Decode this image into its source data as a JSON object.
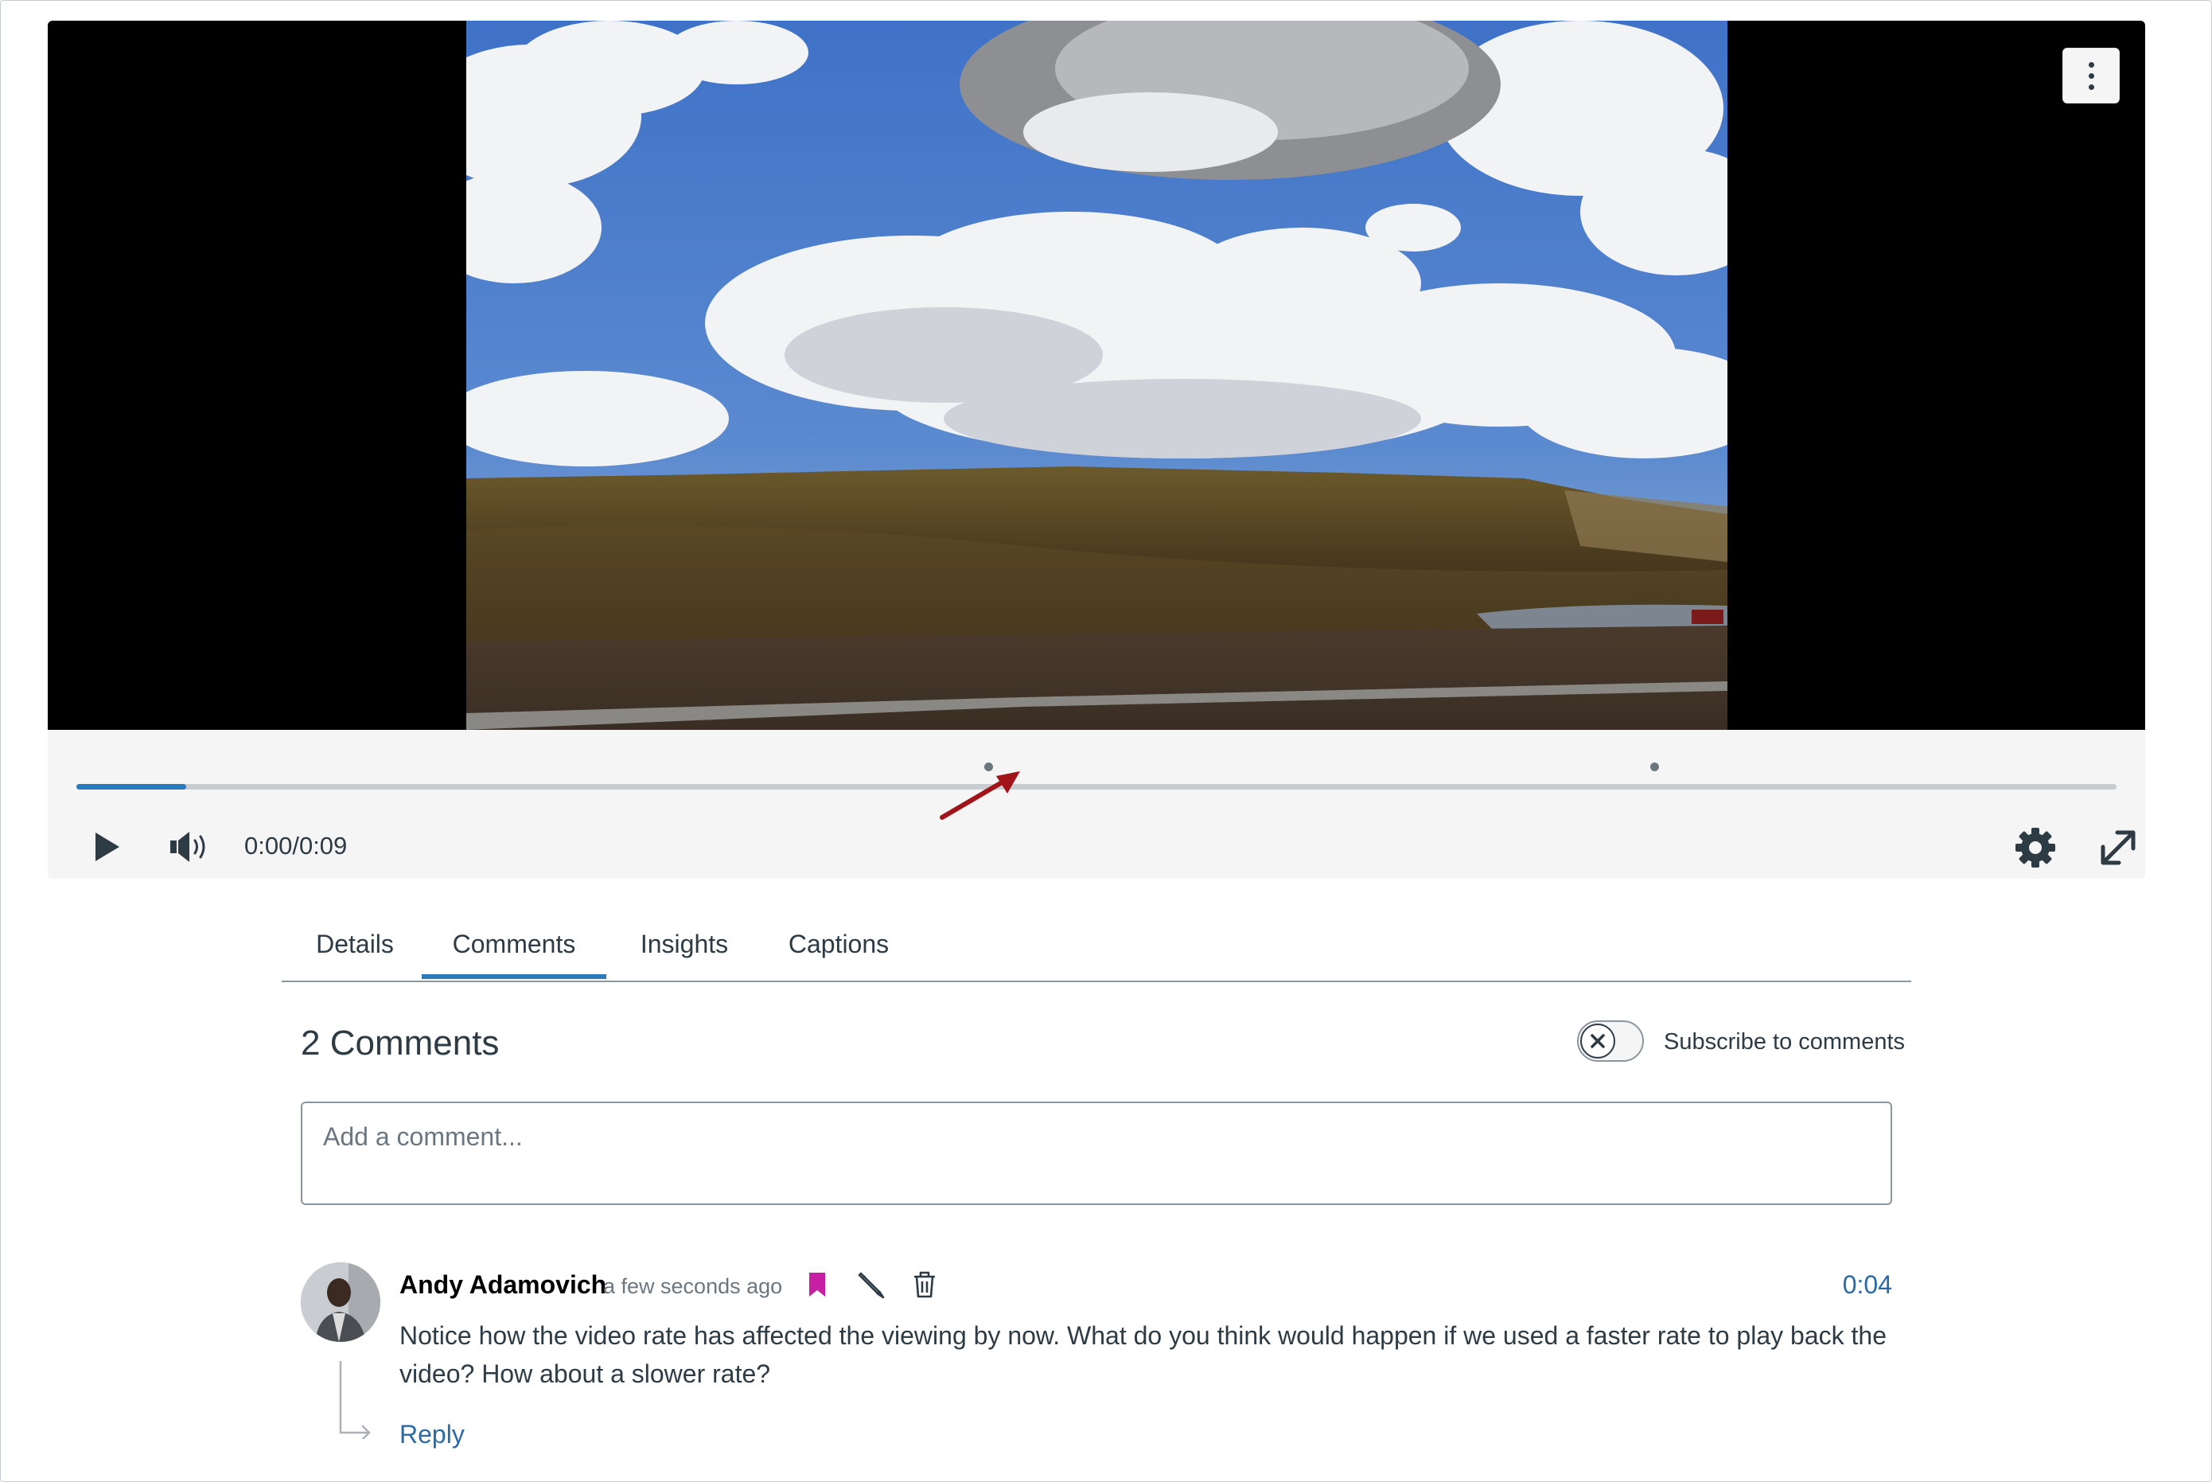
{
  "player": {
    "time_display": "0:00/0:09",
    "progress_fraction": 0.054,
    "comment_marker_times": [
      "0:04",
      "0:07"
    ],
    "icons": {
      "menu": "kebab-icon",
      "play": "play-icon",
      "volume": "volume-icon",
      "settings": "gear-icon",
      "fullscreen": "expand-icon"
    }
  },
  "tabs": [
    {
      "label": "Details"
    },
    {
      "label": "Comments",
      "active": true
    },
    {
      "label": "Insights"
    },
    {
      "label": "Captions"
    }
  ],
  "comments_section": {
    "heading": "2 Comments",
    "subscribe_label": "Subscribe to comments",
    "subscribed": false,
    "input_placeholder": "Add a comment..."
  },
  "comments": [
    {
      "author": "Andy Adamovich",
      "time_ago": "a few seconds ago",
      "timestamp": "0:04",
      "body": "Notice how the video rate has affected the viewing by now. What do you think would happen if we used a faster rate to play back the video? How about a slower rate?",
      "reply_label": "Reply",
      "icons": [
        "bookmark-icon",
        "pencil-icon",
        "trash-icon"
      ]
    }
  ],
  "colors": {
    "accent": "#2b7abc",
    "link": "#2b6aa8",
    "bookmark": "#c71fa1",
    "annotation_arrow": "#a0141a",
    "text": "#2d3b45"
  }
}
